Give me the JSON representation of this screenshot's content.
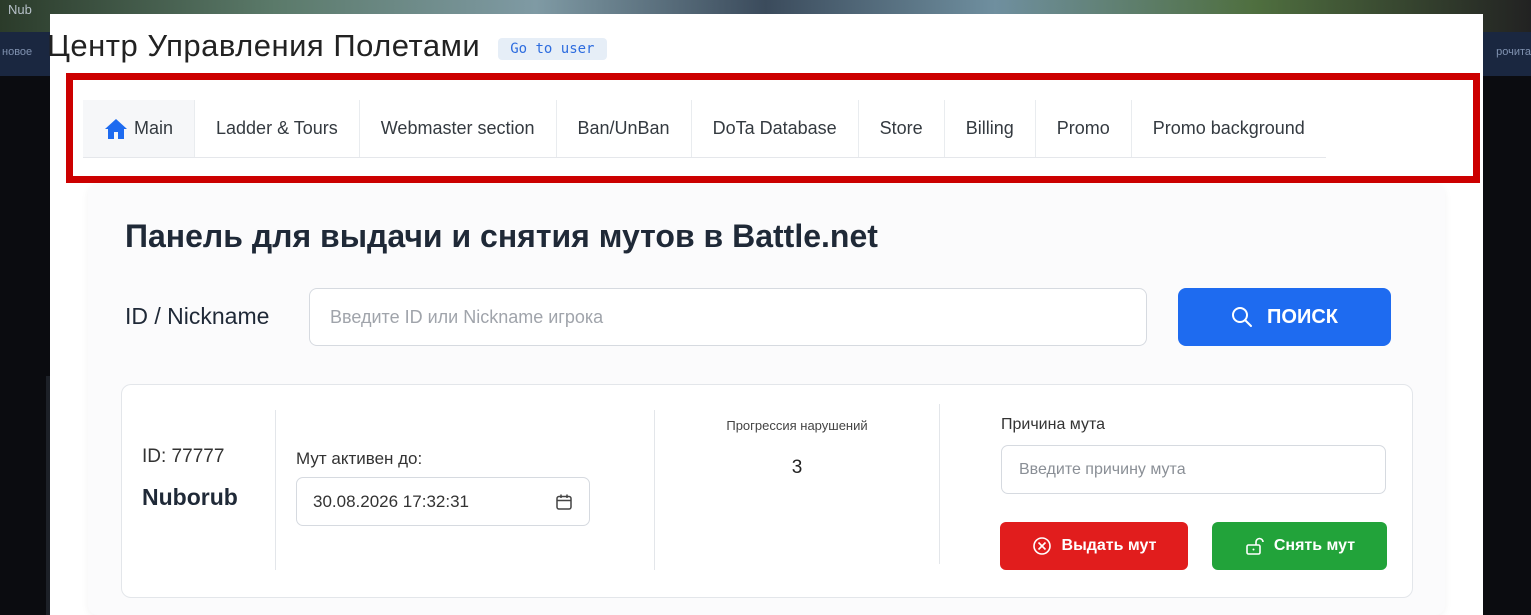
{
  "background": {
    "banner_left_text": "Nub",
    "stripe_left_text": "новое",
    "stripe_right_text": "рочита"
  },
  "header": {
    "title": "Центр  Управления  Полетами",
    "go_to_user_label": "Go to user"
  },
  "nav": {
    "items": [
      {
        "label": "Main",
        "icon": "home-icon",
        "active": true
      },
      {
        "label": "Ladder & Tours"
      },
      {
        "label": "Webmaster section"
      },
      {
        "label": "Ban/UnBan"
      },
      {
        "label": "DoTa Database"
      },
      {
        "label": "Store"
      },
      {
        "label": "Billing"
      },
      {
        "label": "Promo"
      },
      {
        "label": "Promo background"
      }
    ],
    "highlight_color": "#cc0000"
  },
  "panel": {
    "title": "Панель для выдачи и снятия мутов в Battle.net",
    "search": {
      "label": "ID / Nickname",
      "placeholder": "Введите ID или Nickname игрока",
      "button_label": "ПОИСК",
      "button_icon": "search-icon",
      "button_color": "#1e6bf0"
    },
    "user": {
      "id_text": "ID: 77777",
      "nickname": "Nuborub",
      "mute_until_label": "Мут активен до:",
      "mute_until_value": "30.08.2026 17:32:31",
      "date_icon": "calendar-icon",
      "progression_label": "Прогрессия нарушений",
      "progression_value": "3",
      "reason_label": "Причина мута",
      "reason_placeholder": "Введите причину мута",
      "mute_button_label": "Выдать мут",
      "mute_button_icon": "x-circle-icon",
      "mute_button_color": "#e11d1d",
      "unmute_button_label": "Снять мут",
      "unmute_button_icon": "unlock-icon",
      "unmute_button_color": "#22a33a"
    }
  }
}
